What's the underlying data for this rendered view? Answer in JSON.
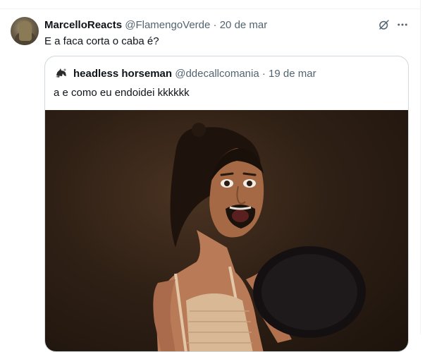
{
  "tweet": {
    "author_name": "MarcelloReacts",
    "handle": "@FlamengoVerde",
    "separator": "·",
    "date": "20 de mar",
    "text": "E a faca corta o caba é?"
  },
  "quoted": {
    "author_name": "headless horseman",
    "handle": "@ddecallcomania",
    "separator": "·",
    "date": "19 de mar",
    "text": "a e como eu endoidei kkkkkk"
  },
  "icons": {
    "grok": "grok-icon",
    "more": "more-icon"
  },
  "colors": {
    "text": "#0f1419",
    "muted": "#536471",
    "border": "#cfd9de"
  }
}
